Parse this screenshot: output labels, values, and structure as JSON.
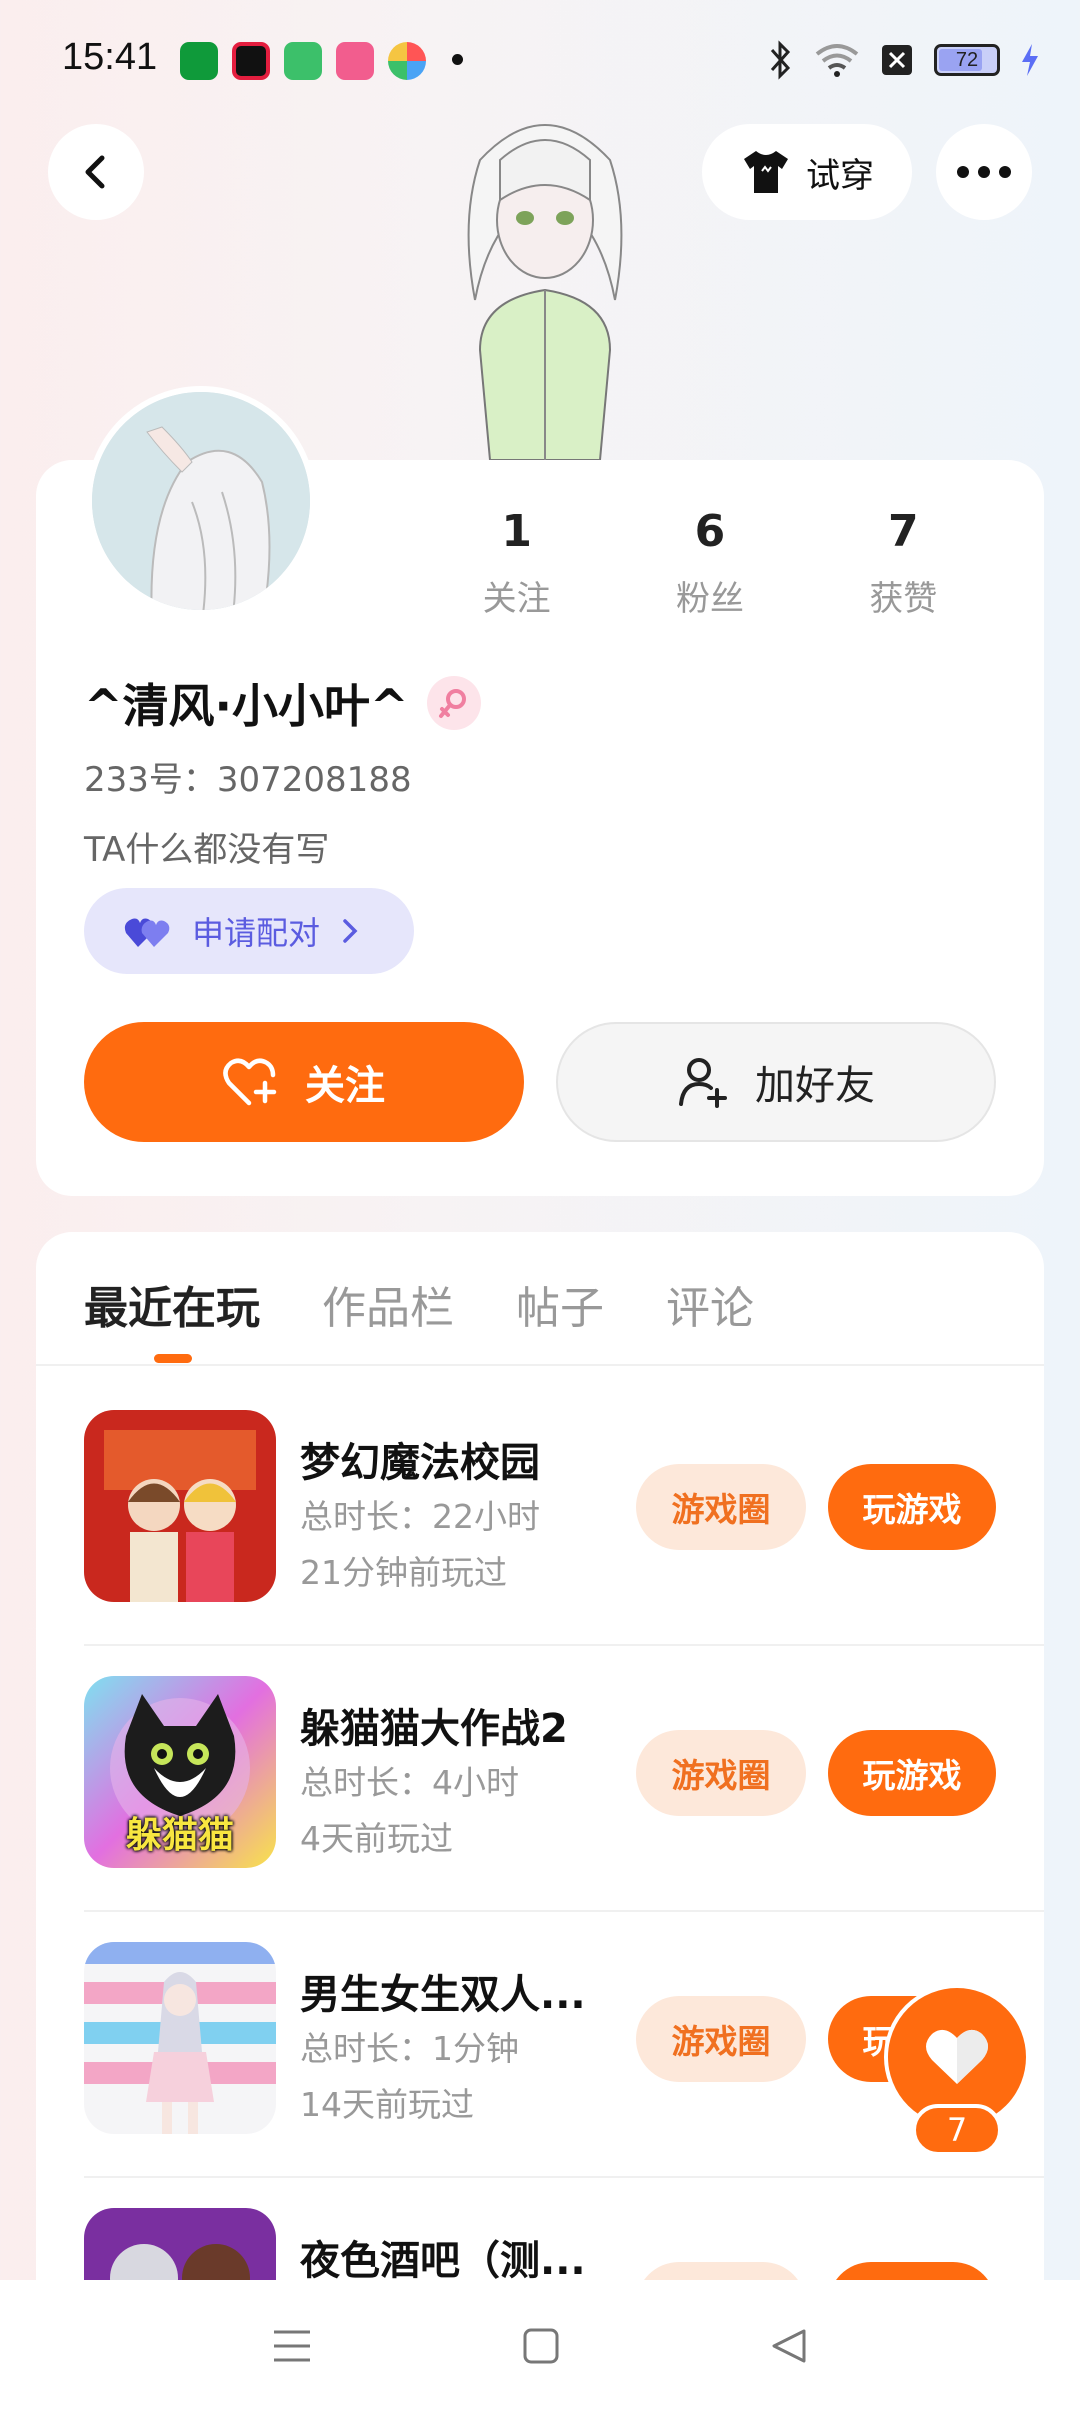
{
  "status_bar": {
    "time": "15:41",
    "battery": "72",
    "app_icons": [
      {
        "name": "oppo-app-icon",
        "color": "#0f9a3a"
      },
      {
        "name": "video-app-icon",
        "color": "#e41e3f"
      },
      {
        "name": "green-app-icon",
        "color": "#3cc06a"
      },
      {
        "name": "bilibili-app-icon",
        "color": "#f25d8e"
      },
      {
        "name": "color-wheel-app-icon",
        "color": "#4aa3f5"
      }
    ]
  },
  "header": {
    "tryon_label": "试穿"
  },
  "profile": {
    "stats": [
      {
        "value": "1",
        "label": "关注"
      },
      {
        "value": "6",
        "label": "粉丝"
      },
      {
        "value": "7",
        "label": "获赞"
      }
    ],
    "username": "^清风·小小叶^",
    "uid": "233号：307208188",
    "bio": "TA什么都没有写",
    "pair_label": "申请配对",
    "follow_label": "关注",
    "add_friend_label": "加好友"
  },
  "tabs": [
    {
      "label": "最近在玩",
      "active": true
    },
    {
      "label": "作品栏",
      "active": false
    },
    {
      "label": "帖子",
      "active": false
    },
    {
      "label": "评论",
      "active": false
    }
  ],
  "games": [
    {
      "title": "梦幻魔法校园",
      "duration": "总时长：22小时",
      "last_played": "21分钟前玩过",
      "circle_label": "游戏圈",
      "play_label": "玩游戏"
    },
    {
      "title": "躲猫猫大作战2",
      "duration": "总时长：4小时",
      "last_played": "4天前玩过",
      "circle_label": "游戏圈",
      "play_label": "玩游戏",
      "icon_text": "躲猫猫"
    },
    {
      "title": "男生女生双人...",
      "duration": "总时长：1分钟",
      "last_played": "14天前玩过",
      "circle_label": "游戏圈",
      "play_label": "玩游戏"
    },
    {
      "title": "夜色酒吧（测...",
      "duration": "",
      "last_played": "",
      "circle_label": "",
      "play_label": ""
    }
  ],
  "like_fab": {
    "count": "7"
  },
  "colors": {
    "accent": "#ff6b0f",
    "pair_bg": "#e6e6fb",
    "pair_text": "#5b5ce0"
  }
}
